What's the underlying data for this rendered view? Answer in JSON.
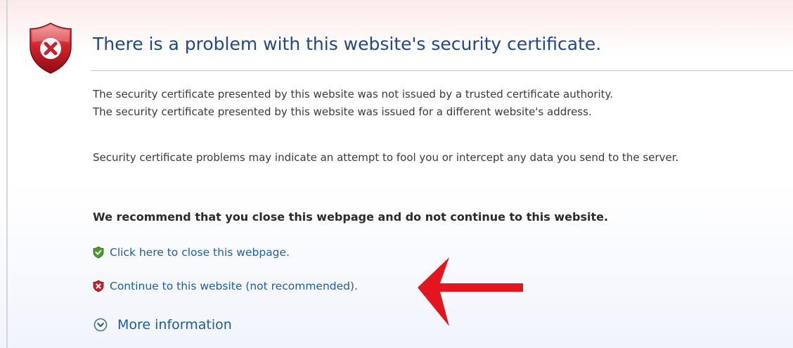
{
  "header": {
    "title": "There is a problem with this website's security certificate."
  },
  "messages": {
    "line1": "The security certificate presented by this website was not issued by a trusted certificate authority.",
    "line2": "The security certificate presented by this website was issued for a different website's address.",
    "warning": "Security certificate problems may indicate an attempt to fool you or intercept any data you send to the server.",
    "recommendation": "We recommend that you close this webpage and do not continue to this website."
  },
  "actions": {
    "close": "Click here to close this webpage.",
    "continue": "Continue to this website (not recommended).",
    "more_info": "More information"
  },
  "icons": {
    "header": "error-shield-icon",
    "close": "green-shield-check-icon",
    "continue": "red-shield-x-icon",
    "more_info": "chevron-down-circle-icon",
    "annotation": "red-arrow-icon"
  },
  "colors": {
    "title": "#1f4a86",
    "link": "#1b5fa8",
    "error_red": "#c8232c",
    "ok_green": "#4a9a2a",
    "annotation_red": "#e3151e"
  }
}
